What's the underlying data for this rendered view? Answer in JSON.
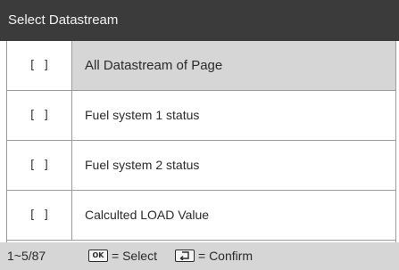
{
  "header": {
    "title": "Select Datastream"
  },
  "list": {
    "rows": [
      {
        "checkbox": "[  ]",
        "label": "All Datastream of Page",
        "selected": true
      },
      {
        "checkbox": "[  ]",
        "label": "Fuel system 1 status",
        "selected": false
      },
      {
        "checkbox": "[  ]",
        "label": "Fuel system 2 status",
        "selected": false
      },
      {
        "checkbox": "[  ]",
        "label": "Calculted LOAD Value",
        "selected": false
      }
    ]
  },
  "footer": {
    "page_indicator": "1~5/87",
    "ok_key_label": "OK",
    "ok_action": "= Select",
    "back_key_icon": "return-arrow-icon",
    "back_action": "= Confirm"
  },
  "colors": {
    "title_bar": "#3b3b3b",
    "selected_row": "#d6d6d6",
    "status_bar": "#d6d6d6",
    "border": "#9a9a9a"
  }
}
